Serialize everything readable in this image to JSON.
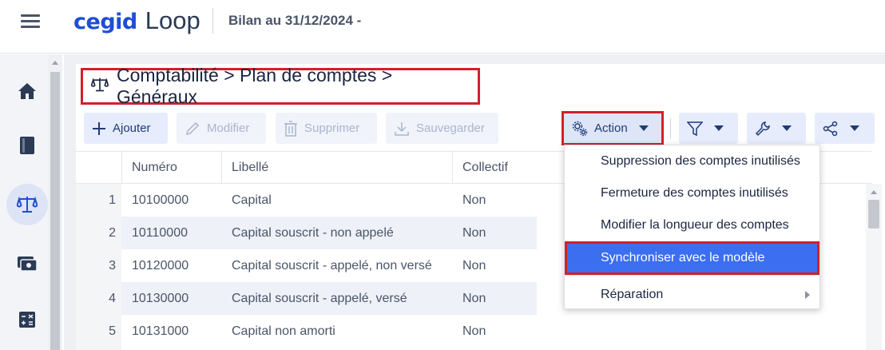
{
  "header": {
    "brand_cegid": "cegid",
    "brand_loop": "Loop",
    "context": "Bilan au 31/12/2024 -"
  },
  "leftnav": {
    "items": [
      {
        "icon": "home-icon",
        "active": false
      },
      {
        "icon": "book-icon",
        "active": false
      },
      {
        "icon": "scale-icon",
        "active": true
      },
      {
        "icon": "cash-icon",
        "active": false
      },
      {
        "icon": "calculator-icon",
        "active": false
      }
    ]
  },
  "page": {
    "title": "Comptabilité > Plan de comptes > Généraux"
  },
  "toolbar": {
    "add_label": "Ajouter",
    "edit_label": "Modifier",
    "delete_label": "Supprimer",
    "save_label": "Sauvegarder",
    "action_label": "Action"
  },
  "grid": {
    "columns": [
      "Numéro",
      "Libellé",
      "Collectif"
    ],
    "rows": [
      {
        "n": "1",
        "numero": "10100000",
        "libelle": "Capital",
        "collectif": "Non"
      },
      {
        "n": "2",
        "numero": "10110000",
        "libelle": "Capital souscrit - non appelé",
        "collectif": "Non"
      },
      {
        "n": "3",
        "numero": "10120000",
        "libelle": "Capital souscrit - appelé, non versé",
        "collectif": "Non"
      },
      {
        "n": "4",
        "numero": "10130000",
        "libelle": "Capital souscrit - appelé, versé",
        "collectif": "Non"
      },
      {
        "n": "5",
        "numero": "10131000",
        "libelle": "Capital non amorti",
        "collectif": "Non"
      }
    ]
  },
  "action_menu": {
    "items": [
      "Suppression des comptes inutilisés",
      "Fermeture des comptes inutilisés",
      "Modifier la longueur des comptes",
      "Synchroniser avec le modèle",
      "Réparation"
    ],
    "selected": "Synchroniser avec le modèle"
  },
  "colors": {
    "brand_blue": "#1d4ed8",
    "highlight_red": "#d2202a",
    "menu_selected": "#3c6ef0"
  }
}
